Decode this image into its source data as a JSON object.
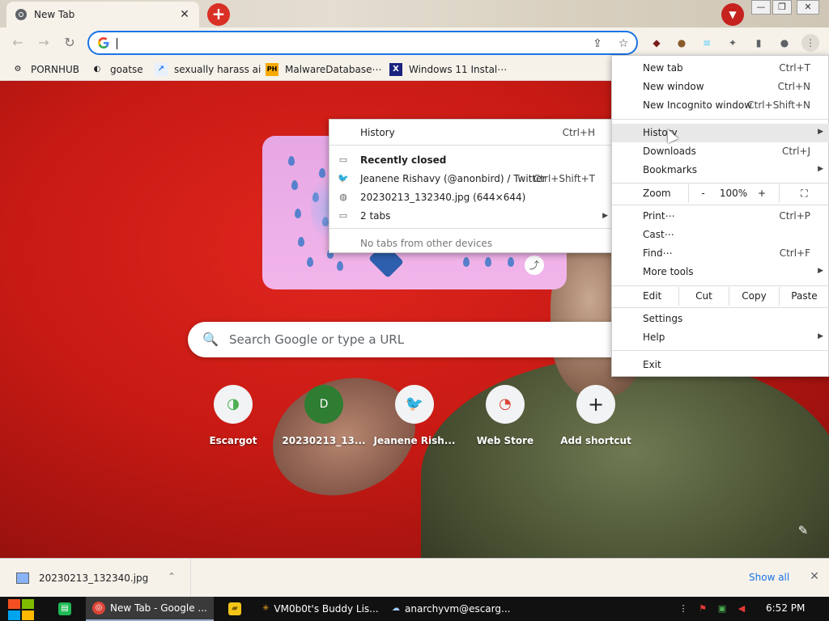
{
  "tab": {
    "title": "New Tab",
    "close": "✕"
  },
  "window_controls": {
    "minimize": "—",
    "maximize": "❐",
    "close": "✕"
  },
  "toolbar": {
    "back": "←",
    "forward": "→",
    "reload": "↻",
    "omnibox_value": "",
    "share": "⇪",
    "star": "☆"
  },
  "extensions": [
    {
      "name": "ublock",
      "glyph": "◆",
      "color": "#7a1c1c"
    },
    {
      "name": "avatar-ext",
      "glyph": "●",
      "color": "#8b5a2b"
    },
    {
      "name": "flag-ext",
      "glyph": "≡",
      "color": "#55cdfc"
    },
    {
      "name": "puzzle",
      "glyph": "✦",
      "color": "#5f6368"
    },
    {
      "name": "sidepanel",
      "glyph": "▮",
      "color": "#5f6368"
    },
    {
      "name": "profile",
      "glyph": "●",
      "color": "#5f6368"
    },
    {
      "name": "menu",
      "glyph": "⋮",
      "color": "#5f6368"
    }
  ],
  "bookmarks": [
    {
      "label": "PORNHUB",
      "icon": "⚙",
      "icon_bg": "transparent",
      "icon_color": "#333"
    },
    {
      "label": "goatse",
      "icon": "◐",
      "icon_bg": "transparent",
      "icon_color": "#333"
    },
    {
      "label": "sexually harass ai",
      "icon": "↗",
      "icon_bg": "#e8f0fe",
      "icon_color": "#1a73e8"
    },
    {
      "label": "MalwareDatabase⋯",
      "icon": "PH",
      "icon_bg": "#f7a900",
      "icon_color": "#000"
    },
    {
      "label": "Windows 11 Instal⋯",
      "icon": "X",
      "icon_bg": "#1a237e",
      "icon_color": "#fff"
    }
  ],
  "search": {
    "placeholder": "Search Google or type a URL",
    "icon": "🔍"
  },
  "shortcuts": [
    {
      "label": "Escargot",
      "glyph": "◑",
      "color": "#4caf50"
    },
    {
      "label": "20230213_13...",
      "glyph": "D",
      "color": "#2e7d32"
    },
    {
      "label": "Jeanene Rish...",
      "glyph": "🐦",
      "color": "#1da1f2"
    },
    {
      "label": "Web Store",
      "glyph": "◔",
      "color": "#db4437"
    },
    {
      "label": "Add shortcut",
      "glyph": "+",
      "color": "#202124"
    }
  ],
  "history_menu": {
    "title": "History",
    "title_shortcut": "Ctrl+H",
    "recently_closed": "Recently closed",
    "items": [
      {
        "label": "Jeanene Rishavy (@anonbird) / Twitter",
        "shortcut": "Ctrl+Shift+T",
        "icon": "🐦"
      },
      {
        "label": "20230213_132340.jpg (644×644)",
        "shortcut": "",
        "icon": "◍"
      },
      {
        "label": "2 tabs",
        "shortcut": "",
        "icon": "▭"
      }
    ],
    "no_tabs": "No tabs from other devices"
  },
  "main_menu": {
    "items_top": [
      {
        "label": "New tab",
        "shortcut": "Ctrl+T"
      },
      {
        "label": "New window",
        "shortcut": "Ctrl+N"
      },
      {
        "label": "New Incognito window",
        "shortcut": "Ctrl+Shift+N"
      }
    ],
    "items_mid": [
      {
        "label": "History",
        "shortcut": "",
        "arrow": "▶"
      },
      {
        "label": "Downloads",
        "shortcut": "Ctrl+J",
        "arrow": ""
      },
      {
        "label": "Bookmarks",
        "shortcut": "",
        "arrow": "▶"
      }
    ],
    "zoom": {
      "label": "Zoom",
      "minus": "-",
      "value": "100%",
      "plus": "+",
      "fullscreen": "⛶"
    },
    "items_tools": [
      {
        "label": "Print⋯",
        "shortcut": "Ctrl+P",
        "arrow": ""
      },
      {
        "label": "Cast⋯",
        "shortcut": "",
        "arrow": ""
      },
      {
        "label": "Find⋯",
        "shortcut": "Ctrl+F",
        "arrow": ""
      },
      {
        "label": "More tools",
        "shortcut": "",
        "arrow": "▶"
      }
    ],
    "edit": {
      "label": "Edit",
      "cut": "Cut",
      "copy": "Copy",
      "paste": "Paste"
    },
    "items_settings": [
      {
        "label": "Settings",
        "arrow": ""
      },
      {
        "label": "Help",
        "arrow": "▶"
      }
    ],
    "exit": "Exit"
  },
  "downloads": {
    "filename": "20230213_132340.jpg",
    "show_all": "Show all",
    "chevron": "⌃",
    "close": "✕"
  },
  "taskbar": {
    "items": [
      {
        "label": "",
        "icon": "▤",
        "icon_bg": "#1db954",
        "active": false
      },
      {
        "label": "New Tab - Google ...",
        "icon": "◎",
        "icon_bg": "#db4437",
        "active": true
      },
      {
        "label": "",
        "icon": "▰",
        "icon_bg": "#f5c518",
        "active": false
      },
      {
        "label": "VM0b0t's Buddy Lis...",
        "icon": "✳",
        "icon_bg": "transparent",
        "active": false
      },
      {
        "label": "anarchyvm@escarg...",
        "icon": "☁",
        "icon_bg": "transparent",
        "active": false
      }
    ],
    "clock": "6:52 PM"
  },
  "accent_color": "#1a73e8"
}
